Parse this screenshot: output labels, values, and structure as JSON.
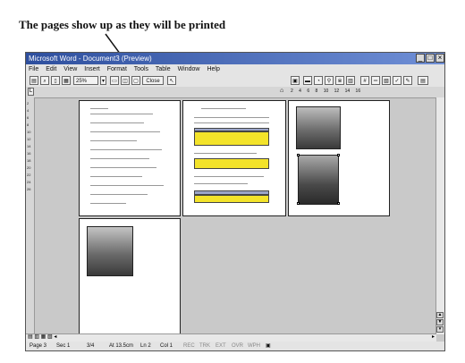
{
  "caption": "The pages show up as they will be printed",
  "window": {
    "title": "Microsoft Word - Document3 (Preview)",
    "controls": [
      "_",
      "□",
      "×"
    ]
  },
  "menu": [
    "File",
    "Edit",
    "View",
    "Insert",
    "Format",
    "Tools",
    "Table",
    "Window",
    "Help"
  ],
  "toolbar": {
    "zoom": "25%",
    "close_label": "Close"
  },
  "ruler_numbers": [
    "2",
    "4",
    "6",
    "8",
    "10",
    "12",
    "14",
    "16"
  ],
  "vruler_numbers": [
    "2",
    "4",
    "6",
    "8",
    "10",
    "12",
    "14",
    "16",
    "18",
    "20",
    "22",
    "24",
    "26"
  ],
  "status": {
    "page": "Page 3",
    "section": "Sec 1",
    "pages": "3/4",
    "at": "At 13.5cm",
    "line": "Ln 2",
    "col": "Col 1",
    "rec": "REC",
    "trk": "TRK",
    "ext": "EXT",
    "ovr": "OVR",
    "wph": "WPH"
  }
}
